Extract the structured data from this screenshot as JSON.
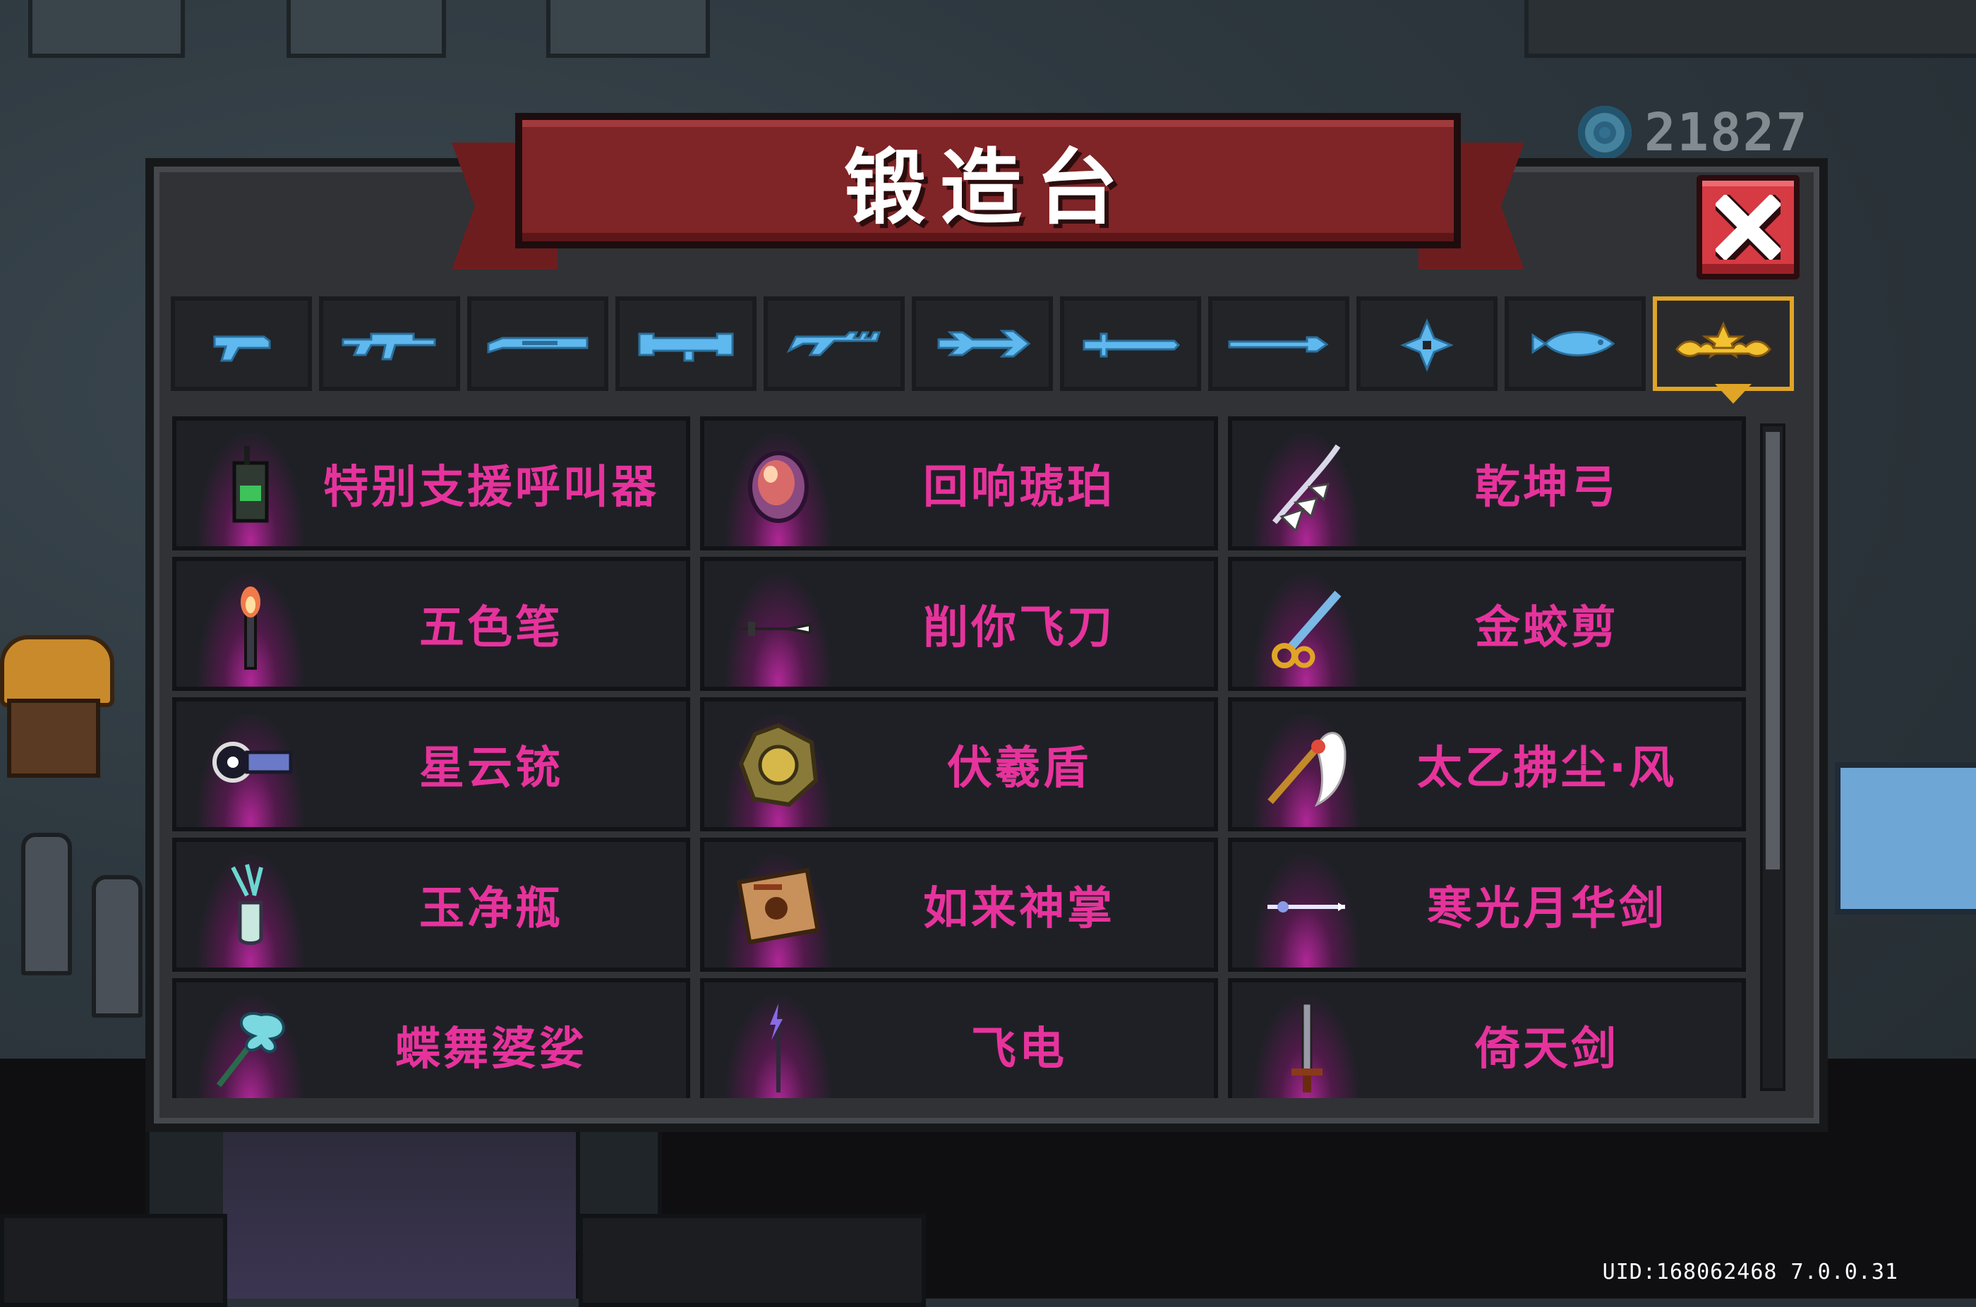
{
  "currency": {
    "icon": "blue-gem-coin-icon",
    "amount": "21827"
  },
  "panel": {
    "title": "锻造台",
    "close_icon": "close-x-icon"
  },
  "tabs": [
    {
      "icon": "pistol-icon",
      "active": false
    },
    {
      "icon": "assault-rifle-icon",
      "active": false
    },
    {
      "icon": "shotgun-icon",
      "active": false
    },
    {
      "icon": "rocket-launcher-icon",
      "active": false
    },
    {
      "icon": "laser-gun-icon",
      "active": false
    },
    {
      "icon": "arrow-icon",
      "active": false
    },
    {
      "icon": "sword-icon",
      "active": false
    },
    {
      "icon": "spear-icon",
      "active": false
    },
    {
      "icon": "shuriken-icon",
      "active": false
    },
    {
      "icon": "fish-icon",
      "active": false
    },
    {
      "icon": "star-crown-icon",
      "active": true
    }
  ],
  "items": [
    {
      "name": "特别支援呼叫器",
      "icon": "walkie-talkie-icon"
    },
    {
      "name": "回响琥珀",
      "icon": "amber-gem-icon"
    },
    {
      "name": "乾坤弓",
      "icon": "winged-bow-icon"
    },
    {
      "name": "五色笔",
      "icon": "flame-brush-icon"
    },
    {
      "name": "削你飞刀",
      "icon": "throwing-knife-icon"
    },
    {
      "name": "金蛟剪",
      "icon": "golden-scissors-icon"
    },
    {
      "name": "星云铳",
      "icon": "nebula-gun-icon"
    },
    {
      "name": "伏羲盾",
      "icon": "bagua-shield-icon"
    },
    {
      "name": "太乙拂尘·风",
      "icon": "whisk-icon"
    },
    {
      "name": "玉净瓶",
      "icon": "jade-vase-icon"
    },
    {
      "name": "如来神掌",
      "icon": "palm-scroll-icon"
    },
    {
      "name": "寒光月华剑",
      "icon": "moon-sword-icon"
    },
    {
      "name": "蝶舞婆娑",
      "icon": "butterfly-staff-icon"
    },
    {
      "name": "飞电",
      "icon": "lightning-spear-icon"
    },
    {
      "name": "倚天剑",
      "icon": "heaven-sword-icon"
    }
  ],
  "footer": {
    "uid": "UID:168062468 7.0.0.31"
  },
  "colors": {
    "item_text": "#e6339c",
    "tab_icon": "#5fb8ee",
    "active_tab": "#e0a526",
    "ribbon": "#7f2427",
    "close": "#d63a43"
  }
}
